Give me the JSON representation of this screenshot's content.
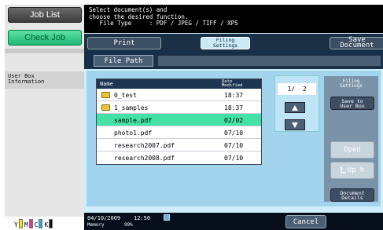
{
  "left_panel": {
    "job_list": "Job List",
    "check_job": "Check Job",
    "user_box_info": "User Box\nInformation",
    "toner": [
      {
        "letter": "Y",
        "color": "#f2e200"
      },
      {
        "letter": "M",
        "color": "#d63aa0"
      },
      {
        "letter": "C",
        "color": "#2aa6e0"
      },
      {
        "letter": "K",
        "color": "#111111"
      }
    ]
  },
  "message": {
    "line1": "Select document(s) and",
    "line2": "choose the desired function.",
    "line3": "   File Type     : PDF / JPEG / TIFF / XPS"
  },
  "tabs": {
    "print": "Print",
    "filing": "Filing\nSettings",
    "save": "Save Document"
  },
  "file_path": {
    "label": "File Path",
    "value": ""
  },
  "file_list": {
    "header_name": "Name",
    "header_date": "Date\nModified",
    "rows": [
      {
        "name": "0_test",
        "date": "18:37",
        "type": "folder"
      },
      {
        "name": "1_samples",
        "date": "18:37",
        "type": "folder"
      },
      {
        "name": "sample.pdf",
        "date": "02/02",
        "type": "file"
      },
      {
        "name": "photo1.pdf",
        "date": "07/10",
        "type": "file"
      },
      {
        "name": "research2007.pdf",
        "date": "07/10",
        "type": "file"
      },
      {
        "name": "research2008.pdf",
        "date": "07/10",
        "type": "file"
      }
    ]
  },
  "pager": {
    "page": "1/  2"
  },
  "filing_panel": {
    "title": "Filing\nSettings",
    "save_to_userbox": "Save to\nUser Box",
    "open": "Open",
    "up": "Up h",
    "document_details": "Document\nDetails"
  },
  "status": {
    "date": "04/10/2009    12:50",
    "memory": "Memory       99%",
    "cancel": "Cancel"
  }
}
